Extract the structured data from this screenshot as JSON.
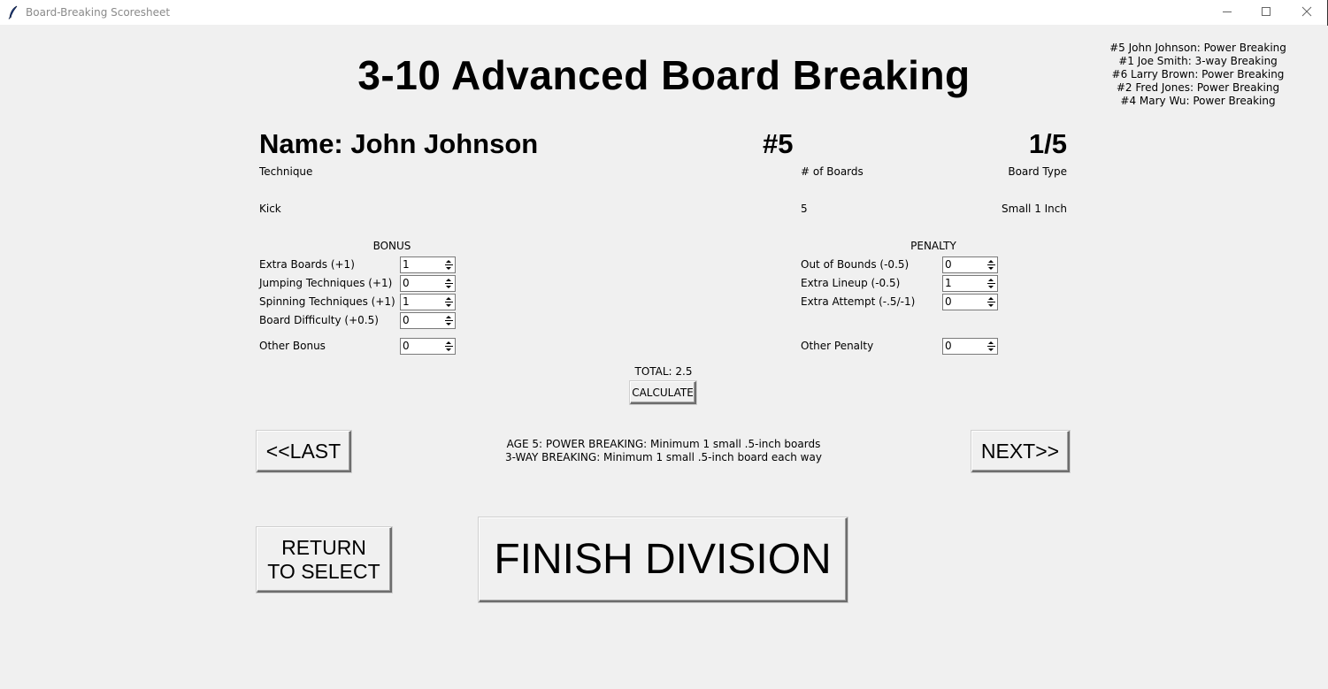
{
  "window": {
    "title": "Board-Breaking Scoresheet",
    "icon": "feather-icon",
    "controls": [
      "minimize",
      "maximize",
      "close"
    ]
  },
  "division_title": "3-10 Advanced Board Breaking",
  "roster": [
    "#5  John Johnson:  Power Breaking",
    "#1  Joe Smith:  3-way Breaking",
    "#6  Larry Brown:  Power Breaking",
    "#2  Fred Jones:  Power Breaking",
    "#4  Mary Wu:  Power Breaking"
  ],
  "competitor": {
    "name": "Name: John Johnson",
    "number": "#5",
    "position": "1/5",
    "technique_label": "Technique",
    "technique_value": "Kick",
    "boards_label": "# of Boards",
    "boards_value": "5",
    "board_type_label": "Board Type",
    "board_type_value": "Small 1 Inch"
  },
  "bonus": {
    "header": "BONUS",
    "items": [
      {
        "label": "Extra Boards (+1)",
        "value": "1"
      },
      {
        "label": "Jumping Techniques (+1)",
        "value": "0"
      },
      {
        "label": "Spinning Techniques (+1)",
        "value": "1"
      },
      {
        "label": "Board Difficulty (+0.5)",
        "value": "0"
      }
    ],
    "other": {
      "label": "Other Bonus",
      "value": "0"
    }
  },
  "penalty": {
    "header": "PENALTY",
    "items": [
      {
        "label": "Out of Bounds (-0.5)",
        "value": "0"
      },
      {
        "label": "Extra Lineup (-0.5)",
        "value": "1"
      },
      {
        "label": "Extra Attempt (-.5/-1)",
        "value": "0"
      }
    ],
    "other": {
      "label": "Other Penalty",
      "value": "0"
    }
  },
  "total": "TOTAL: 2.5",
  "buttons": {
    "calculate": "CALCULATE",
    "last": "<<LAST",
    "next": "NEXT>>",
    "return_line1": "RETURN",
    "return_line2": "TO SELECT",
    "finish": "FINISH DIVISION"
  },
  "rules": {
    "line1": "AGE 5: POWER BREAKING:  Minimum 1 small .5-inch boards",
    "line2": "3-WAY BREAKING:  Minimum 1 small .5-inch board each way"
  }
}
